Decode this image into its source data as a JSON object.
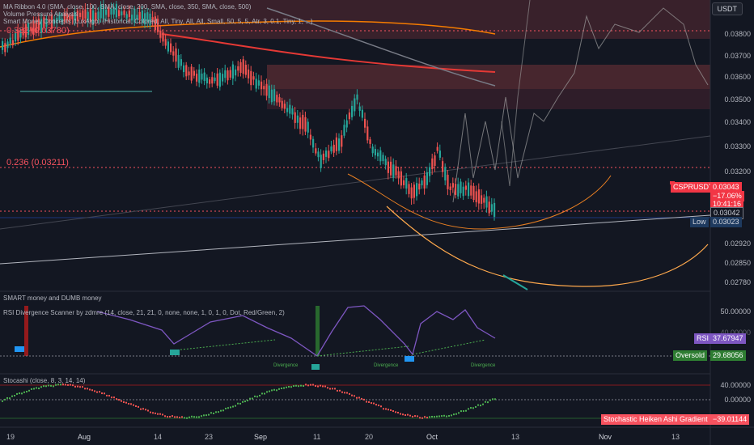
{
  "header": {
    "currency_button": "USDT",
    "indicators": [
      "MA Ribbon 4.0 (SMA, close, 100, SMA, close, 200, SMA, close, 350, SMA, close, 500)",
      "Volume Pressure Analysis",
      "Smart Money Concepts (LuxAlgo) (Historical, Colored, All, Tiny, All, All, Small, 50, 5, 5, Atr, 3, 0.1, Tiny, 1, ...)"
    ]
  },
  "fib_levels": {
    "upper": "0.382 (0.03780)",
    "lower": "0.236 (0.03211)"
  },
  "price_axis": [
    "0.03800",
    "0.03700",
    "0.03600",
    "0.03500",
    "0.03400",
    "0.03300",
    "0.03200",
    "0.03042",
    "0.02920",
    "0.02850",
    "0.02780"
  ],
  "price_tags": {
    "symbol": "CSPRUSDT",
    "last": "0.03043",
    "change": "−17.06%",
    "countdown": "10:41:16",
    "level": "0.03042",
    "low_label": "Low",
    "low_value": "0.03023"
  },
  "panes": {
    "smart_money": "SMART money and DUMB money",
    "rsi_title": "RSI Divergence Scanner by zdmre (14, close, 21, 21, 0, none, none, 1, 0, 1, 0, Dot, Red/Green, 2)",
    "rsi_axis_top": "50.00000",
    "rsi_axis_mid": "40.00000",
    "rsi_tag_label": "RSI",
    "rsi_tag_value": "37.67947",
    "oversold_label": "Oversold",
    "oversold_value": "29.68056",
    "divergence": "Divergence",
    "stoch_title": "Stocashi (close, 8, 3, 14, 14)",
    "stoch_axis_top": "40.00000",
    "stoch_axis_mid": "0.00000",
    "stoch_tag": "Stochastic Heiken Ashi Gradient",
    "stoch_value": "−39.01144"
  },
  "time_axis": [
    "19",
    "Aug",
    "14",
    "23",
    "Sep",
    "11",
    "20",
    "Oct",
    "13",
    "Nov",
    "13"
  ],
  "colors": {
    "bg": "#131722",
    "up": "#26a69a",
    "down": "#ef5350",
    "fib": "#f7525f",
    "purple": "#7e57c2"
  }
}
